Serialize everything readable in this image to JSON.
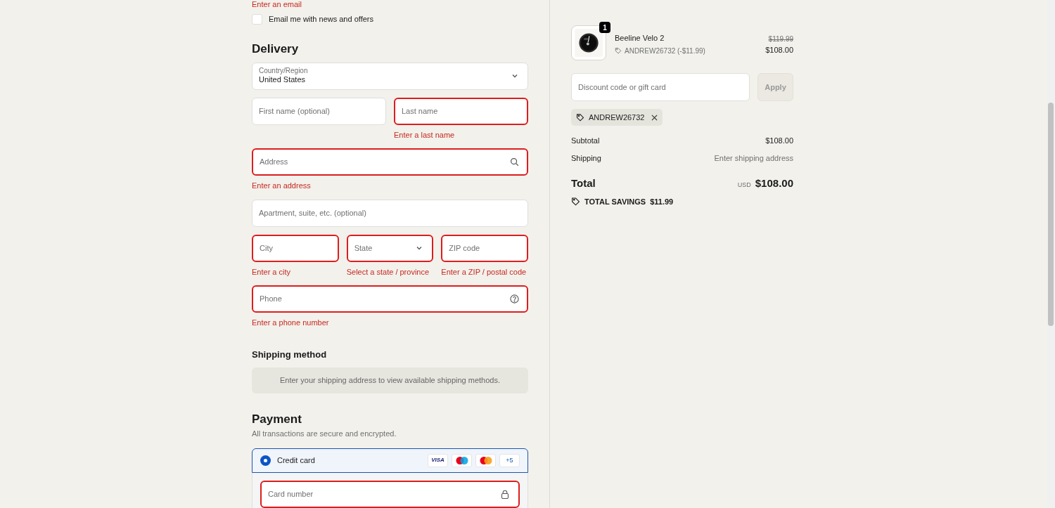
{
  "contact": {
    "error": "Enter an email",
    "newsletter": {
      "label": "Email me with news and offers",
      "checked": false
    }
  },
  "delivery": {
    "title": "Delivery",
    "rows": [
      [
        {
          "kind": "select",
          "label": "Country/Region",
          "value": "United States",
          "invalid": false
        }
      ],
      [
        {
          "kind": "text",
          "placeholder": "First name (optional)",
          "invalid": false
        },
        {
          "kind": "text",
          "placeholder": "Last name",
          "invalid": true,
          "error": "Enter a last name"
        }
      ],
      [
        {
          "kind": "search",
          "placeholder": "Address",
          "invalid": true,
          "error": "Enter an address"
        }
      ],
      [
        {
          "kind": "text",
          "placeholder": "Apartment, suite, etc. (optional)",
          "invalid": false
        }
      ],
      [
        {
          "kind": "text",
          "placeholder": "City",
          "invalid": true,
          "error": "Enter a city"
        },
        {
          "kind": "select",
          "placeholder": "State",
          "invalid": true,
          "error": "Select a state / province"
        },
        {
          "kind": "text",
          "placeholder": "ZIP code",
          "invalid": true,
          "error": "Enter a ZIP / postal code"
        }
      ],
      [
        {
          "kind": "help",
          "placeholder": "Phone",
          "invalid": true,
          "error": "Enter a phone number"
        }
      ]
    ]
  },
  "shipping_method": {
    "title": "Shipping method",
    "message": "Enter your shipping address to view available shipping methods."
  },
  "payment": {
    "title": "Payment",
    "subtitle": "All transactions are secure and encrypted.",
    "methods": [
      {
        "label": "Credit card",
        "selected": true,
        "badges": [
          {
            "kind": "visa",
            "text": "VISA"
          },
          {
            "kind": "maestro"
          },
          {
            "kind": "mastercard"
          },
          {
            "kind": "more",
            "text": "+5"
          }
        ]
      }
    ],
    "card_number": {
      "placeholder": "Card number",
      "invalid": true
    }
  },
  "summary": {
    "item": {
      "quantity": "1",
      "name": "Beeline Velo 2",
      "discount": "ANDREW26732 (-$11.99)",
      "original_price": "$119.99",
      "price": "$108.00"
    },
    "discount_field": {
      "placeholder": "Discount code or gift card"
    },
    "apply_button": {
      "label": "Apply",
      "disabled": true
    },
    "applied_code": "ANDREW26732",
    "lines": [
      {
        "label": "Subtotal",
        "value": "$108.00",
        "muted": false
      },
      {
        "label": "Shipping",
        "value": "Enter shipping address",
        "muted": true
      }
    ],
    "total": {
      "label": "Total",
      "currency": "USD",
      "amount": "$108.00"
    },
    "savings": {
      "label": "TOTAL SAVINGS",
      "amount": "$11.99"
    }
  }
}
